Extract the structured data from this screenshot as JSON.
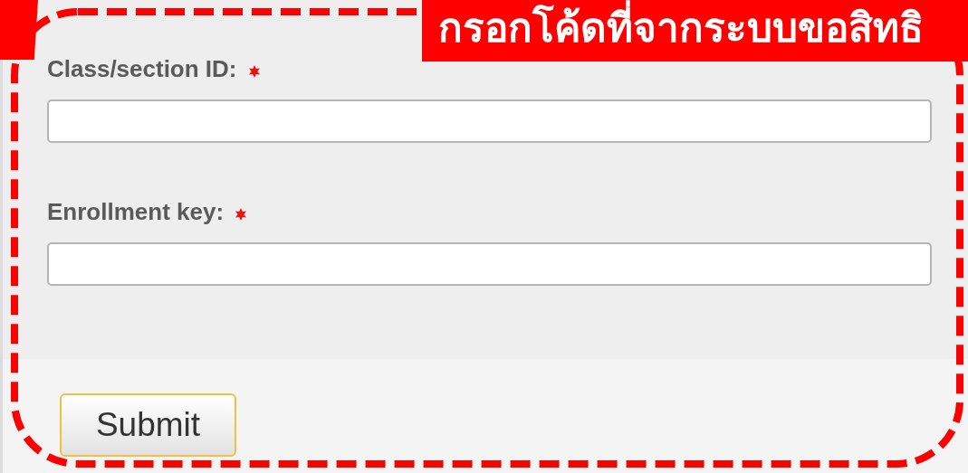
{
  "annotation": {
    "label": "กรอกโค้ดที่จากระบบขอสิทธิ"
  },
  "fields": [
    {
      "label": "Class/section ID:",
      "required": true
    },
    {
      "label": "Enrollment key:",
      "required": true
    }
  ],
  "submit": {
    "label": "Submit"
  }
}
